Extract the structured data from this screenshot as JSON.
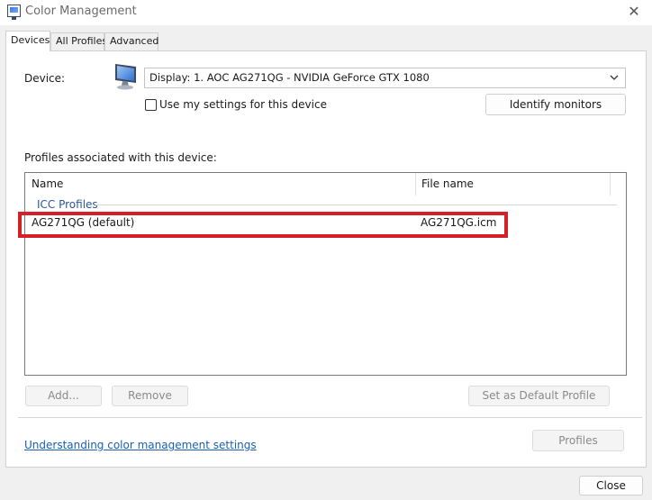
{
  "window": {
    "title": "Color Management",
    "icon": "color-management-icon",
    "close_glyph": "✕"
  },
  "tabs": [
    {
      "label": "Devices",
      "active": true
    },
    {
      "label": "All Profiles",
      "active": false
    },
    {
      "label": "Advanced",
      "active": false
    }
  ],
  "device": {
    "label": "Device:",
    "selected": "Display: 1. AOC AG271QG - NVIDIA GeForce GTX 1080",
    "use_my_settings_label": "Use my settings for this device",
    "use_my_settings_checked": false,
    "identify_label": "Identify monitors"
  },
  "profiles": {
    "heading": "Profiles associated with this device:",
    "columns": [
      "Name",
      "File name"
    ],
    "group_label": "ICC Profiles",
    "rows": [
      {
        "name": "AG271QG (default)",
        "file": "AG271QG.icm"
      }
    ]
  },
  "buttons": {
    "add": "Add...",
    "remove": "Remove",
    "set_default": "Set as Default Profile",
    "profiles": "Profiles",
    "close": "Close"
  },
  "link": {
    "text": "Understanding color management settings"
  },
  "colors": {
    "highlight": "#d61f26",
    "link": "#1a5fb4",
    "group_label": "#2b579a"
  }
}
